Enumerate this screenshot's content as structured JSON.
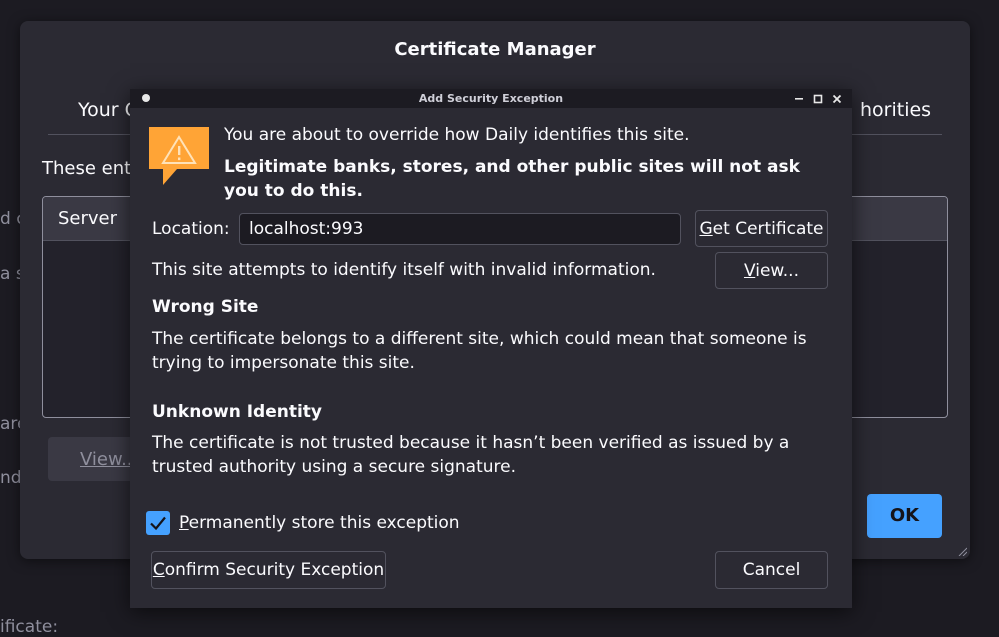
{
  "background": {
    "fragments": [
      "d c",
      "a s",
      "are",
      "nd",
      "ificate:"
    ]
  },
  "cert_manager": {
    "title": "Certificate Manager",
    "tabs": [
      "Your C",
      "horities"
    ],
    "description": "These ent",
    "table": {
      "column_server": "Server"
    },
    "view_label": "View...",
    "ok_label": "OK"
  },
  "exception_dialog": {
    "title": "Add Security Exception",
    "intro": "You are about to override how Daily identifies this site.",
    "warning": "Legitimate banks, stores, and other public sites will not ask you to do this.",
    "location_label": "Location:",
    "location_value": "localhost:993",
    "get_certificate": {
      "mnemonic": "G",
      "rest": "et Certificate"
    },
    "view": {
      "mnemonic": "V",
      "rest": "iew..."
    },
    "site_info": "This site attempts to identify itself with invalid information.",
    "wrong_site": {
      "heading": "Wrong Site",
      "body": "The certificate belongs to a different site, which could mean that someone is trying to impersonate this site."
    },
    "unknown_identity": {
      "heading": "Unknown Identity",
      "body": "The certificate is not trusted because it hasn’t been verified as issued by a trusted authority using a secure signature."
    },
    "permanent": {
      "mnemonic": "P",
      "rest": "ermanently store this exception"
    },
    "confirm": {
      "mnemonic": "C",
      "rest": "onfirm Security Exception"
    },
    "cancel_label": "Cancel"
  },
  "colors": {
    "accent": "#45a1ff",
    "warning_icon": "#ffa436",
    "dialog_bg": "#2b2a33",
    "page_bg": "#1c1b22"
  },
  "icons": {
    "warning": "warning-triangle-icon",
    "checkbox": "checkmark-icon",
    "minimize": "minimize-icon",
    "maximize": "maximize-icon",
    "close": "close-icon"
  }
}
